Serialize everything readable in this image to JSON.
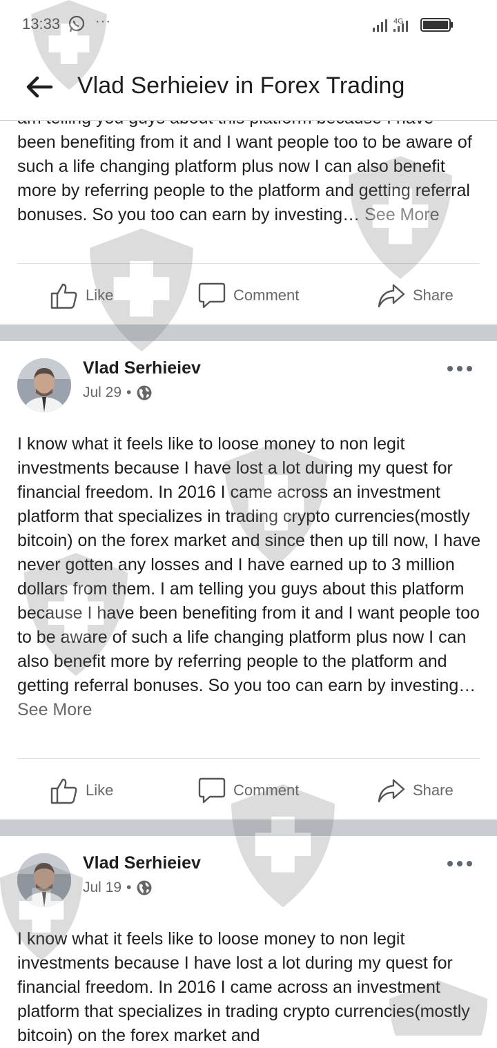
{
  "status_bar": {
    "time": "13:33",
    "icons": [
      "whatsapp-icon",
      "more-notifications-icon",
      "signal-icon",
      "4g-signal-icon",
      "battery-icon"
    ]
  },
  "app_bar": {
    "title": "Vlad Serhieiev in Forex Trading",
    "back_icon": "arrow-left-icon"
  },
  "posts": [
    {
      "partial": true,
      "cut_line": "am telling you guys about this platform because I have",
      "text": "been benefiting from it and I want people too to be aware of such a life changing platform plus now I can also benefit more by referring people to the platform and getting referral bonuses. So you too can earn by investing…",
      "see_more": "See More",
      "actions": {
        "like": "Like",
        "comment": "Comment",
        "share": "Share"
      }
    },
    {
      "author": "Vlad Serhieiev",
      "date": "Jul 29",
      "text": "I know what it feels like to loose money to non legit investments because I have lost a lot during my quest for financial freedom. In 2016 I came across an investment platform that specializes in trading crypto currencies(mostly bitcoin) on the forex market and since then up till now, I have never gotten any losses and I have earned up to 3 million dollars from them. I am telling you guys about this platform because I have been benefiting from it and I want people too to be aware of such a life changing platform plus now I can also benefit more by referring people to the platform and getting referral bonuses. So you too can earn by investing…",
      "see_more": "See More",
      "actions": {
        "like": "Like",
        "comment": "Comment",
        "share": "Share"
      }
    },
    {
      "author": "Vlad Serhieiev",
      "date": "Jul 19",
      "text": "I know what it feels like to loose money to non legit investments because I have lost a lot during my quest for financial freedom. In 2016 I came across an investment platform that specializes in trading crypto currencies(mostly bitcoin) on the forex market and"
    }
  ],
  "colors": {
    "text": "#1c1e21",
    "secondary_text": "#65676b",
    "separator_band": "#c9ccd1"
  }
}
